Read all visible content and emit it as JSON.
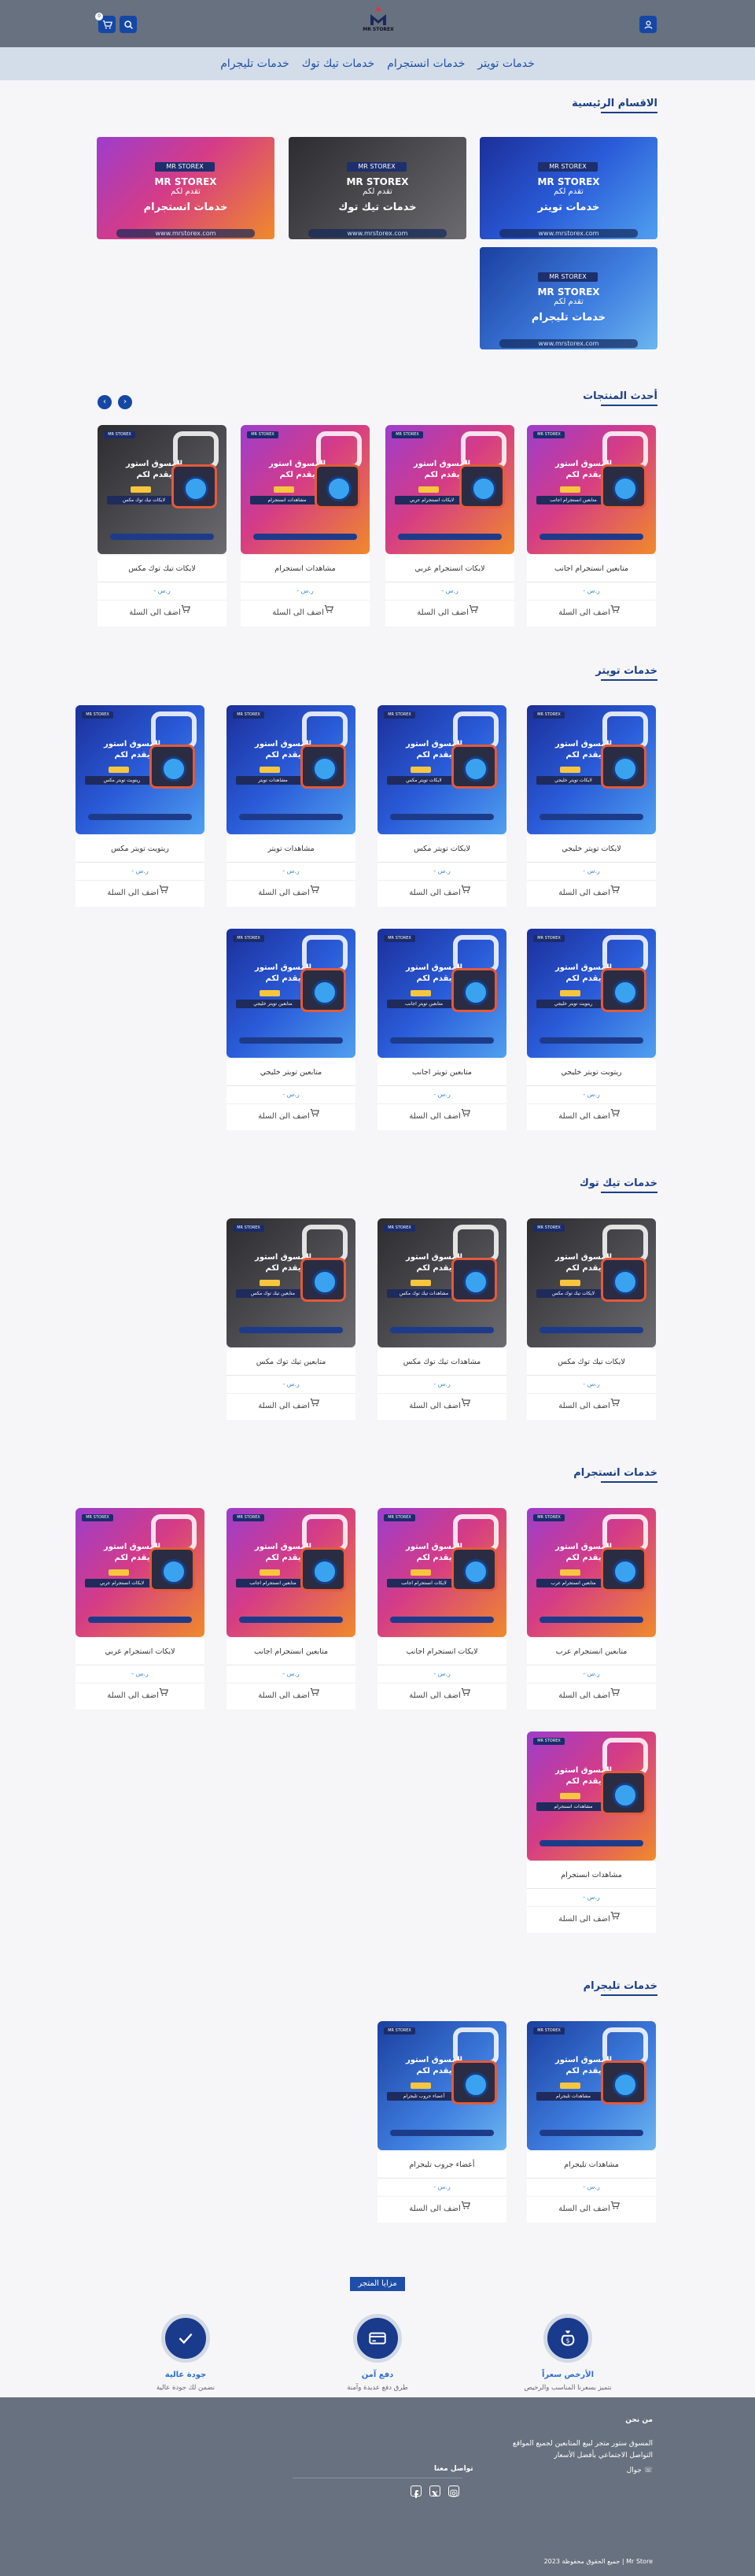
{
  "header": {
    "logo_text": "MR STOREX",
    "cart_count": "0"
  },
  "nav": {
    "items": [
      "خدمات تويتر",
      "خدمات انستجرام",
      "خدمات تيك توك",
      "خدمات تليجرام"
    ]
  },
  "main_categories": {
    "title": "الاقسام الرئيسية",
    "items": [
      {
        "brand": "MR STOREX",
        "line1": "MR STOREX",
        "line2": "تقدم لكم",
        "caption": "خدمات تويتر",
        "url": "www.mrstorex.com",
        "theme": "twitter"
      },
      {
        "brand": "MR STOREX",
        "line1": "MR STOREX",
        "line2": "تقدم لكم",
        "caption": "خدمات تيك توك",
        "url": "www.mrstorex.com",
        "theme": "tiktok"
      },
      {
        "brand": "MR STOREX",
        "line1": "MR STOREX",
        "line2": "تقدم لكم",
        "caption": "خدمات انستجرام",
        "url": "www.mrstorex.com",
        "theme": "instagram"
      },
      {
        "brand": "MR STOREX",
        "line1": "MR STOREX",
        "line2": "تقدم لكم",
        "caption": "خدمات تليجرام",
        "url": "www.mrstorex.com",
        "theme": "telegram"
      }
    ]
  },
  "latest": {
    "title": "أحدث المنتجات",
    "products": [
      {
        "name": "متابعين انستجرام اجانب",
        "price": "- ر.س",
        "theme": "instagram"
      },
      {
        "name": "لايكات انستجرام عربي",
        "price": "- ر.س",
        "theme": "instagram"
      },
      {
        "name": "مشاهدات انستجرام",
        "price": "- ر.س",
        "theme": "instagram"
      },
      {
        "name": "لايكات تيك توك مكس",
        "price": "- ر.س",
        "theme": "tiktok"
      }
    ]
  },
  "twitter_section": {
    "title": "خدمات تويتر",
    "products": [
      {
        "name": "لايكات تويتر خليجي",
        "price": "- ر.س",
        "theme": "twitter"
      },
      {
        "name": "لايكات تويتر مكس",
        "price": "- ر.س",
        "theme": "twitter"
      },
      {
        "name": "مشاهدات تويتر",
        "price": "- ر.س",
        "theme": "twitter"
      },
      {
        "name": "ريتويت تويتر مكس",
        "price": "- ر.س",
        "theme": "twitter"
      },
      {
        "name": "ريتويت تويتر خليجي",
        "price": "- ر.س",
        "theme": "twitter"
      },
      {
        "name": "متابعين تويتر اجانب",
        "price": "- ر.س",
        "theme": "twitter"
      },
      {
        "name": "متابعين تويتر خليجي",
        "price": "- ر.س",
        "theme": "twitter"
      }
    ]
  },
  "tiktok_section": {
    "title": "خدمات تيك توك",
    "products": [
      {
        "name": "لايكات تيك توك مكس",
        "price": "- ر.س",
        "theme": "tiktok"
      },
      {
        "name": "مشاهدات تيك توك مكس",
        "price": "- ر.س",
        "theme": "tiktok"
      },
      {
        "name": "متابعين تيك توك مكس",
        "price": "- ر.س",
        "theme": "tiktok"
      }
    ]
  },
  "instagram_section": {
    "title": "خدمات انستجرام",
    "products": [
      {
        "name": "متابعين انستجرام عرب",
        "price": "- ر.س",
        "theme": "instagram"
      },
      {
        "name": "لايكات انستجرام اجانب",
        "price": "- ر.س",
        "theme": "instagram"
      },
      {
        "name": "متابعين انستجرام اجانب",
        "price": "- ر.س",
        "theme": "instagram"
      },
      {
        "name": "لايكات انستجرام عربي",
        "price": "- ر.س",
        "theme": "instagram"
      },
      {
        "name": "مشاهدات انستجرام",
        "price": "- ر.س",
        "theme": "instagram"
      }
    ]
  },
  "telegram_section": {
    "title": "خدمات تليجرام",
    "products": [
      {
        "name": "مشاهدات تليجرام",
        "price": "- ر.س",
        "theme": "telegram"
      },
      {
        "name": "أعضاء جروب تليجرام",
        "price": "- ر.س",
        "theme": "telegram"
      }
    ]
  },
  "card_text": {
    "add_to_cart": "اضف الى السلة",
    "promo_line1": "المسوق استور",
    "promo_line2": "يقدم لكم",
    "mr_badge": "MR STOREX"
  },
  "features": {
    "title": "مزايا المتجر",
    "items": [
      {
        "title": "الأرخص سعراً",
        "subtitle": "نتميز بسعرنا المناسب والرخيص",
        "icon": "money-bag-icon"
      },
      {
        "title": "دفع آمن",
        "subtitle": "طرق دفع عديدة وآمنة",
        "icon": "credit-card-icon"
      },
      {
        "title": "جودة عالية",
        "subtitle": "نضمن لك جودة عالية",
        "icon": "badge-check-icon"
      }
    ]
  },
  "footer": {
    "about_title": "من نحن",
    "about_text": "المسوق ستور متجر لبيع المتابعين لجميع المواقع التواصل الاجتماعي بأفضل الأسعار",
    "phone_label": "جوال",
    "social_title": "تواصل معنا",
    "copyright": "جميع الحقوق محفوظة 2023 | Mr Store"
  },
  "colors": {
    "header_bg": "#68717f",
    "nav_bg": "#d3dde9",
    "accent": "#1547a5",
    "section_title": "#1b3f86",
    "price": "#3c8ad6"
  }
}
